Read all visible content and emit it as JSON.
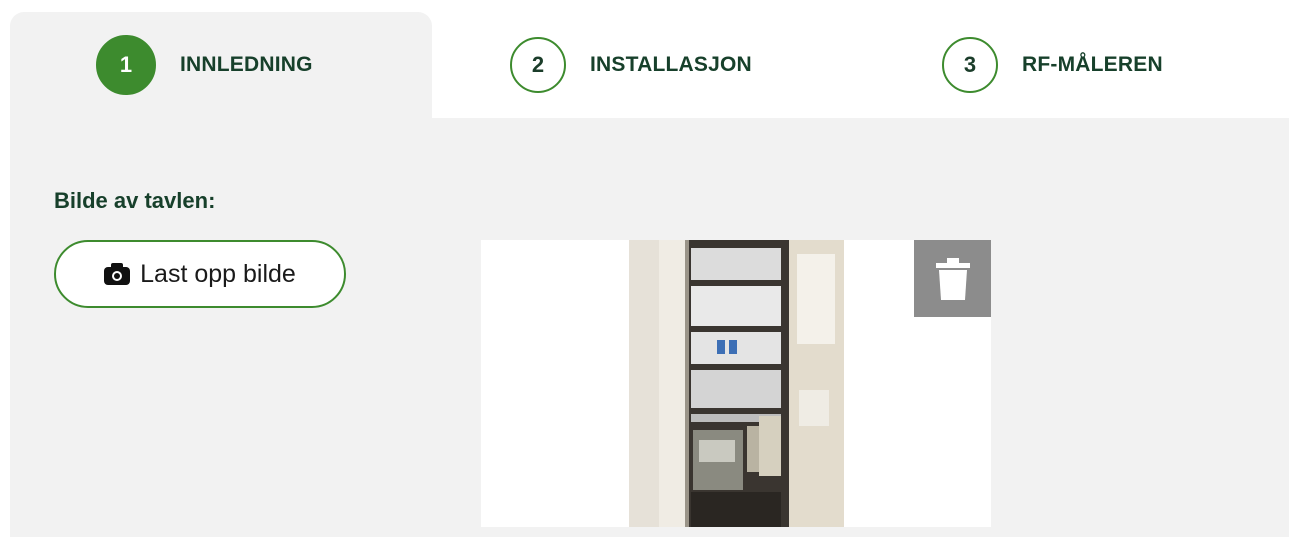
{
  "steps": [
    {
      "number": "1",
      "label": "INNLEDNING"
    },
    {
      "number": "2",
      "label": "INSTALLASJON"
    },
    {
      "number": "3",
      "label": "RF-MÅLEREN"
    }
  ],
  "section": {
    "label": "Bilde av tavlen:",
    "upload_button_label": "Last opp bilde"
  },
  "icons": {
    "upload": "camera-icon",
    "delete": "trash-icon"
  },
  "colors": {
    "accent_green": "#3d8b2e",
    "dark_green_text": "#17402b",
    "panel_bg": "#f2f2f2",
    "delete_bg": "#8c8c8c"
  }
}
